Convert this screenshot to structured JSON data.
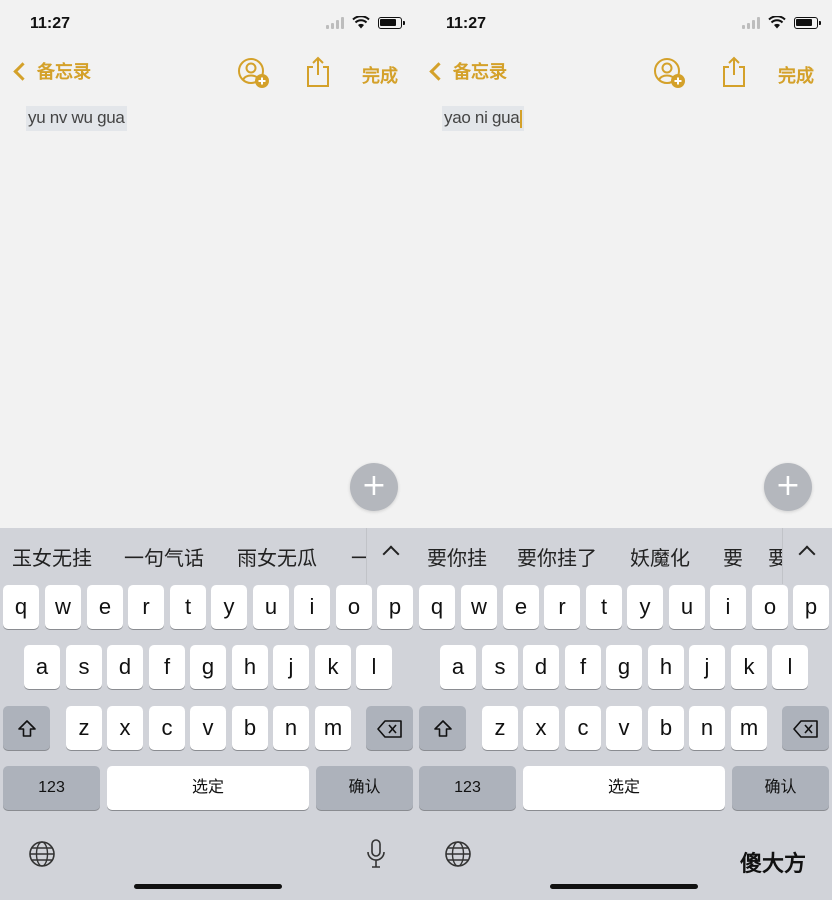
{
  "phones": [
    {
      "time": "11:27",
      "back_label": "备忘录",
      "done_label": "完成",
      "note_text": "yu nv wu gua",
      "candidates": [
        "玉女无挂",
        "一句气话",
        "雨女无瓜",
        "一"
      ],
      "keyboard": {
        "row1": [
          "q",
          "w",
          "e",
          "r",
          "t",
          "y",
          "u",
          "i",
          "o",
          "p"
        ],
        "row2": [
          "a",
          "s",
          "d",
          "f",
          "g",
          "h",
          "j",
          "k",
          "l"
        ],
        "row3": [
          "z",
          "x",
          "c",
          "v",
          "b",
          "n",
          "m"
        ],
        "numbers_label": "123",
        "space_label": "选定",
        "confirm_label": "确认"
      }
    },
    {
      "time": "11:27",
      "back_label": "备忘录",
      "done_label": "完成",
      "note_text": "yao ni gua",
      "candidates": [
        "要你挂",
        "要你挂了",
        "妖魔化",
        "要",
        "要"
      ],
      "keyboard": {
        "row1": [
          "q",
          "w",
          "e",
          "r",
          "t",
          "y",
          "u",
          "i",
          "o",
          "p"
        ],
        "row2": [
          "a",
          "s",
          "d",
          "f",
          "g",
          "h",
          "j",
          "k",
          "l"
        ],
        "row3": [
          "z",
          "x",
          "c",
          "v",
          "b",
          "n",
          "m"
        ],
        "numbers_label": "123",
        "space_label": "选定",
        "confirm_label": "确认"
      }
    }
  ],
  "icons": {
    "back": "chevron-left-icon",
    "contact": "add-contact-icon",
    "share": "share-icon",
    "new_note": "plus-icon",
    "collapse": "chevron-up-icon",
    "shift": "shift-icon",
    "delete": "backspace-icon",
    "globe": "globe-icon",
    "mic": "microphone-icon"
  },
  "colors": {
    "accent": "#d4a12a",
    "keyboard_bg": "#d1d3d9",
    "key_dark": "#adb2bb"
  },
  "watermark": "傻大方"
}
